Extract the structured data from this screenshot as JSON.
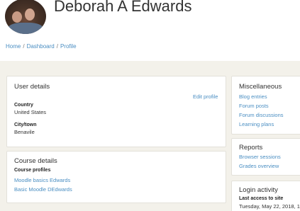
{
  "profile": {
    "name": "Deborah A Edwards"
  },
  "breadcrumb": [
    {
      "label": "Home"
    },
    {
      "label": "Dashboard"
    },
    {
      "label": "Profile"
    }
  ],
  "breadcrumb_separator": "/",
  "user_details": {
    "title": "User details",
    "edit_link": "Edit profile",
    "country_label": "Country",
    "country_value": "United States",
    "city_label": "City/town",
    "city_value": "Benavile"
  },
  "course_details": {
    "title": "Course details",
    "profiles_label": "Course profiles",
    "courses": [
      "Moodle basics Edwards",
      "Basic Moodle DEdwards"
    ]
  },
  "misc": {
    "title": "Miscellaneous",
    "links": [
      "Blog entries",
      "Forum posts",
      "Forum discussions",
      "Learning plans"
    ]
  },
  "reports": {
    "title": "Reports",
    "links": [
      "Browser sessions",
      "Grades overview"
    ]
  },
  "login": {
    "title": "Login activity",
    "last_access_label": "Last access to site",
    "last_access_value": "Tuesday, May 22, 2018, 1:"
  },
  "colors": {
    "link": "#4a8ec2",
    "page_bg": "#f3f1ea",
    "card_bg": "#ffffff"
  }
}
